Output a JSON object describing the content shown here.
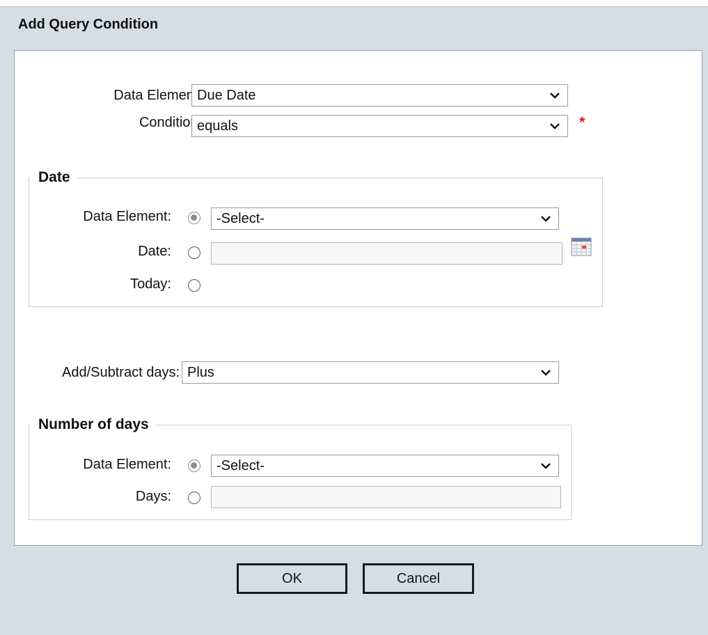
{
  "dialog": {
    "title": "Add Query Condition"
  },
  "form": {
    "data_element_label": "Data Element:",
    "data_element_value": "Due Date",
    "condition_label": "Condition:",
    "condition_value": "equals",
    "required_marker": "*"
  },
  "date_group": {
    "legend": "Date",
    "data_element_label": "Data Element:",
    "data_element_value": "-Select-",
    "data_element_selected": true,
    "date_label": "Date:",
    "date_value": "",
    "date_selected": false,
    "today_label": "Today:",
    "today_selected": false
  },
  "add_subtract": {
    "label": "Add/Subtract days:",
    "value": "Plus"
  },
  "days_group": {
    "legend": "Number of days",
    "data_element_label": "Data Element:",
    "data_element_value": "-Select-",
    "data_element_selected": true,
    "days_label": "Days:",
    "days_value": "",
    "days_selected": false
  },
  "buttons": {
    "ok_label": "OK",
    "cancel_label": "Cancel"
  },
  "colors": {
    "background": "#d7dee3",
    "panel": "#ffffff",
    "required": "#d32020"
  },
  "icons": [
    "chevron-down-icon",
    "calendar-icon"
  ]
}
